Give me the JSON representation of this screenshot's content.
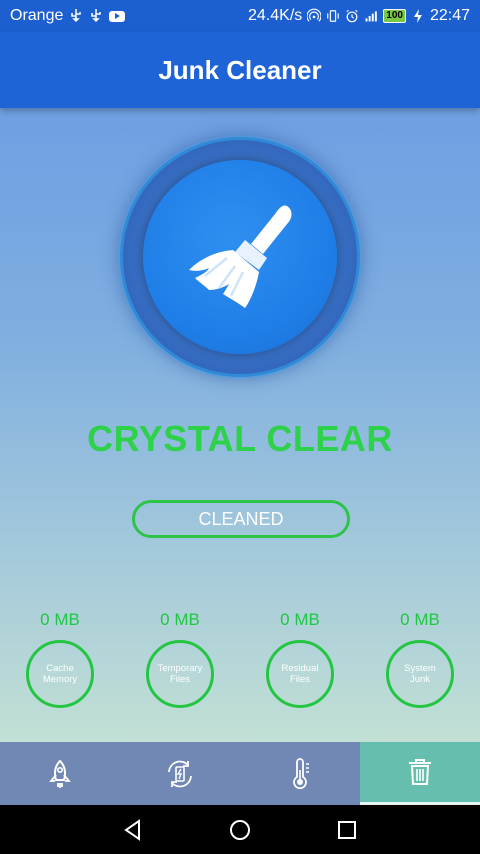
{
  "status_bar": {
    "carrier": "Orange",
    "speed": "24.4K/s",
    "battery": "100",
    "time": "22:47"
  },
  "app_bar": {
    "title": "Junk Cleaner"
  },
  "main": {
    "headline": "CRYSTAL CLEAR",
    "status_button": "CLEANED",
    "stats": [
      {
        "value": "0 MB",
        "label": "Cache Memory"
      },
      {
        "value": "0 MB",
        "label": "Temporary Files"
      },
      {
        "value": "0 MB",
        "label": "Residual Files"
      },
      {
        "value": "0 MB",
        "label": "System Junk"
      }
    ]
  },
  "tabs": [
    {
      "icon": "rocket-icon"
    },
    {
      "icon": "battery-sync-icon"
    },
    {
      "icon": "thermometer-icon"
    },
    {
      "icon": "trash-icon",
      "active": true
    }
  ],
  "colors": {
    "accent_green": "#2ed14a",
    "app_bar": "#1e64d6",
    "active_tab": "#66bfae"
  }
}
